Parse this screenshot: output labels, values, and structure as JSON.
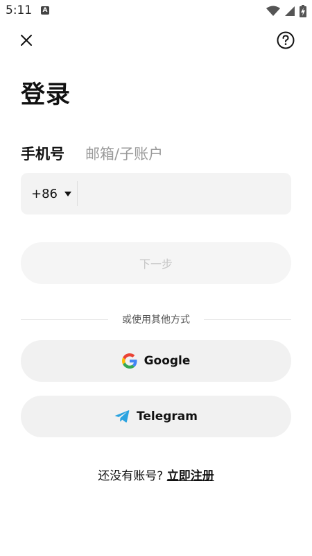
{
  "status_bar": {
    "time": "5:11",
    "a_icon_label": "A",
    "icons": [
      "app-notification-icon",
      "wifi-icon",
      "cell-signal-icon",
      "battery-charging-icon"
    ]
  },
  "topbar": {
    "close_icon": "close-icon",
    "help_icon": "help-circle-icon"
  },
  "page": {
    "title": "登录"
  },
  "tabs": [
    {
      "label": "手机号",
      "active": true
    },
    {
      "label": "邮箱/子账户",
      "active": false
    }
  ],
  "phone": {
    "country_code": "+86",
    "value": "",
    "placeholder": ""
  },
  "next_button": {
    "label": "下一步"
  },
  "divider": {
    "text": "或使用其他方式"
  },
  "social": {
    "google_label": "Google",
    "telegram_label": "Telegram"
  },
  "register": {
    "prompt": "还没有账号?",
    "link": "立即注册"
  },
  "colors": {
    "input_bg": "#f3f3f3",
    "disabled_text": "#c6c6c6",
    "telegram_blue": "#2aa3e0",
    "google_blue": "#4285f4",
    "google_red": "#ea4335",
    "google_yellow": "#fbbc05",
    "google_green": "#34a853"
  }
}
